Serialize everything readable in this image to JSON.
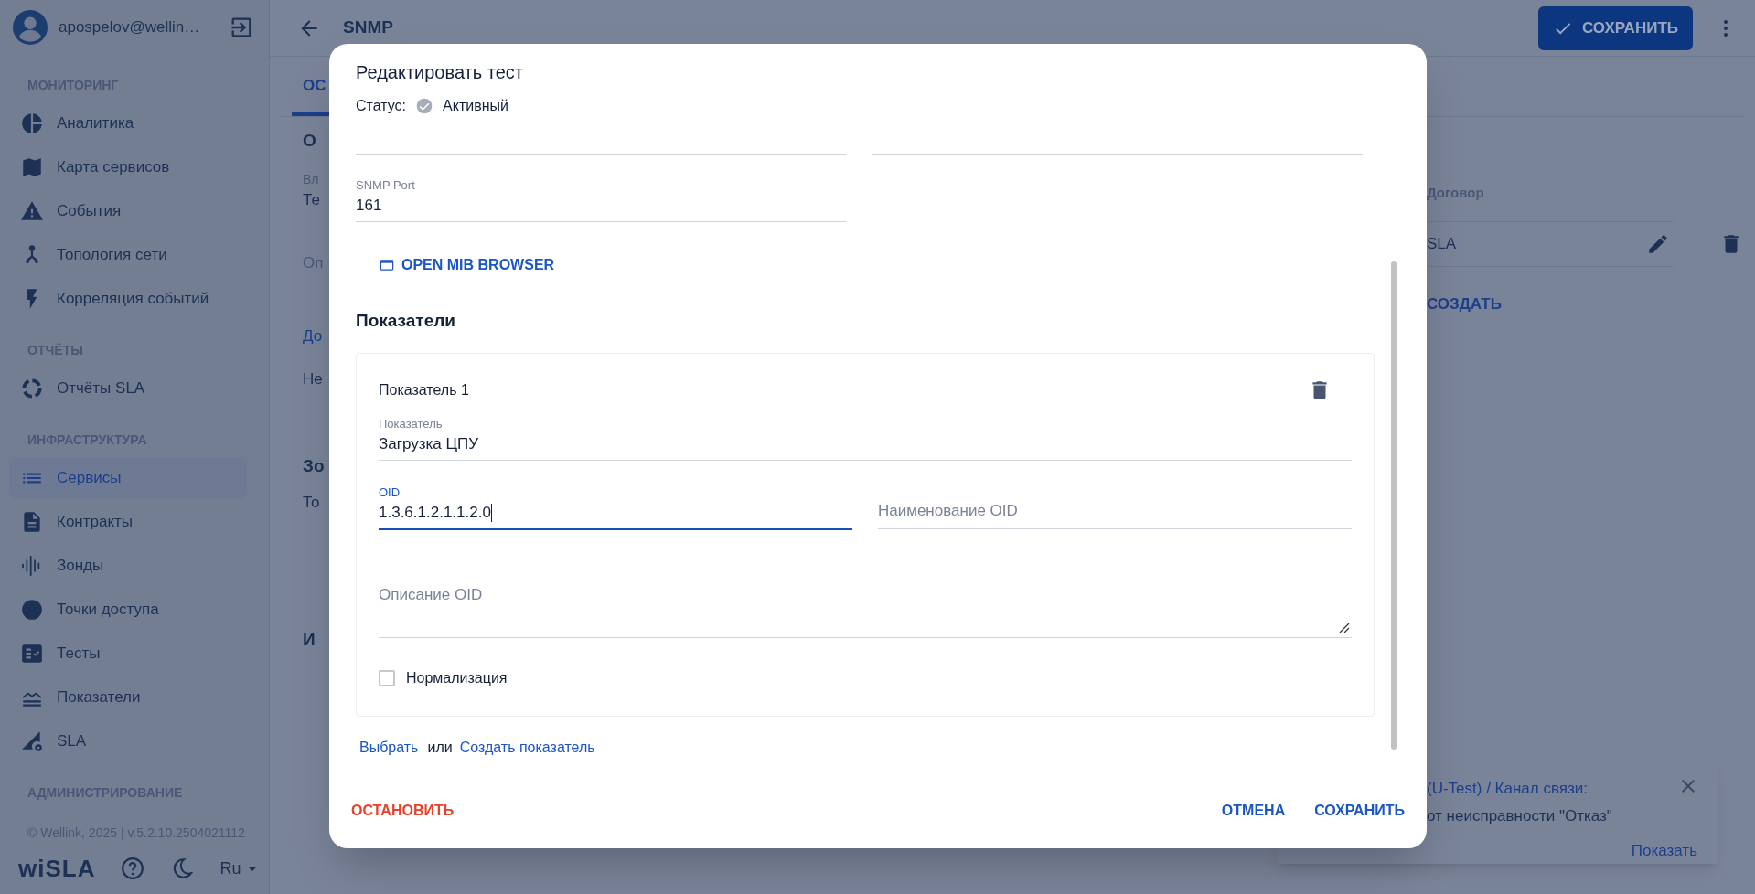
{
  "sidebar": {
    "user": "apospelov@wellin…",
    "sections": [
      {
        "title": "МОНИТОРИНГ",
        "items": [
          {
            "label": "Аналитика",
            "selected": false
          },
          {
            "label": "Карта сервисов",
            "selected": false
          },
          {
            "label": "События",
            "selected": false
          },
          {
            "label": "Топология сети",
            "selected": false
          },
          {
            "label": "Корреляция событий",
            "selected": false
          }
        ]
      },
      {
        "title": "ОТЧЁТЫ",
        "items": [
          {
            "label": "Отчёты SLA",
            "selected": false
          }
        ]
      },
      {
        "title": "ИНФРАСТРУКТУРА",
        "items": [
          {
            "label": "Сервисы",
            "selected": true
          },
          {
            "label": "Контракты",
            "selected": false
          },
          {
            "label": "Зонды",
            "selected": false
          },
          {
            "label": "Точки доступа",
            "selected": false
          },
          {
            "label": "Тесты",
            "selected": false
          },
          {
            "label": "Показатели",
            "selected": false
          },
          {
            "label": "SLA",
            "selected": false
          }
        ]
      },
      {
        "title": "АДМИНИСТРИРОВАНИЕ"
      }
    ],
    "copyright": "© Wellink, 2025 | v.5.2.10.2504021112",
    "logo": "wiSLA",
    "language": "Ru"
  },
  "page": {
    "title": "SNMP",
    "save_button": "СОХРАНИТЬ",
    "tab": "ОС",
    "fragments": [
      {
        "text": "О",
        "kind": "heading"
      },
      {
        "text": "Вл",
        "kind": "label"
      },
      {
        "text": "Те",
        "kind": "value"
      },
      {
        "text": "Оп",
        "kind": "placeholder"
      },
      {
        "text": "До",
        "kind": "link"
      },
      {
        "text": "Не",
        "kind": "value"
      },
      {
        "text": "Зо",
        "kind": "heading"
      },
      {
        "text": "То",
        "kind": "value"
      },
      {
        "text": "И",
        "kind": "heading"
      }
    ],
    "table": {
      "column": "Договор",
      "cell": "SLA"
    },
    "create_link": "СОЗДАТЬ"
  },
  "toast": {
    "line_1": "(U-Test) / Канал связи:",
    "line_2": "от неисправности \"Отказ\"",
    "action": "Показать"
  },
  "dialog": {
    "title": "Редактировать тест",
    "status_label": "Статус:",
    "status": "Активный",
    "port": {
      "label": "SNMP Port",
      "value": "161"
    },
    "mib_button": "OPEN MIB BROWSER",
    "section": "Показатели",
    "indicator": {
      "title": "Показатель 1",
      "metric": {
        "label": "Показатель",
        "value": "Загрузка ЦПУ",
        "focused": false
      },
      "oid": {
        "label": "OID",
        "value": "1.3.6.1.2.1.1.2.0",
        "focused": true
      },
      "oid_name": {
        "placeholder": "Наименование OID"
      },
      "oid_description": {
        "placeholder": "Описание OID"
      },
      "normalize": {
        "label": "Нормализация",
        "checked": false
      }
    },
    "choose_link": "Выбрать",
    "or": "или",
    "create_link": "Создать показатель",
    "stop_button": "ОСТАНОВИТЬ",
    "cancel_button": "ОТМЕНА",
    "save_button": "СОХРАНИТЬ"
  }
}
